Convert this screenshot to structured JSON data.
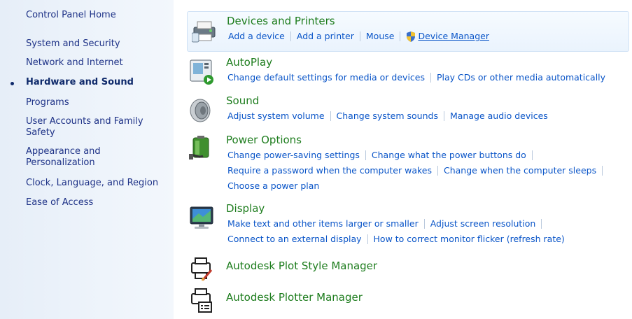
{
  "sidebar": {
    "items": [
      {
        "label": "Control Panel Home"
      },
      {
        "label": "System and Security"
      },
      {
        "label": "Network and Internet"
      },
      {
        "label": "Hardware and Sound"
      },
      {
        "label": "Programs"
      },
      {
        "label": "User Accounts and Family Safety"
      },
      {
        "label": "Appearance and Personalization"
      },
      {
        "label": "Clock, Language, and Region"
      },
      {
        "label": "Ease of Access"
      }
    ]
  },
  "categories": {
    "devices": {
      "title": "Devices and Printers",
      "links": [
        "Add a device",
        "Add a printer",
        "Mouse",
        "Device Manager"
      ],
      "icon": "devices-printers-icon"
    },
    "autoplay": {
      "title": "AutoPlay",
      "links": [
        "Change default settings for media or devices",
        "Play CDs or other media automatically"
      ],
      "icon": "autoplay-icon"
    },
    "sound": {
      "title": "Sound",
      "links": [
        "Adjust system volume",
        "Change system sounds",
        "Manage audio devices"
      ],
      "icon": "speaker-icon"
    },
    "power": {
      "title": "Power Options",
      "links": [
        "Change power-saving settings",
        "Change what the power buttons do",
        "Require a password when the computer wakes",
        "Change when the computer sleeps",
        "Choose a power plan"
      ],
      "icon": "battery-plug-icon"
    },
    "display": {
      "title": "Display",
      "links": [
        "Make text and other items larger or smaller",
        "Adjust screen resolution",
        "Connect to an external display",
        "How to correct monitor flicker (refresh rate)"
      ],
      "icon": "monitor-icon"
    },
    "plotstyle": {
      "title": "Autodesk Plot Style Manager",
      "icon": "plot-style-icon"
    },
    "plotter": {
      "title": "Autodesk Plotter Manager",
      "icon": "plotter-icon"
    }
  },
  "colors": {
    "link": "#0a55c8",
    "category_title": "#1e7d1e",
    "sidebar_text": "#1e3287",
    "sidebar_bg": "#e6eef8"
  }
}
